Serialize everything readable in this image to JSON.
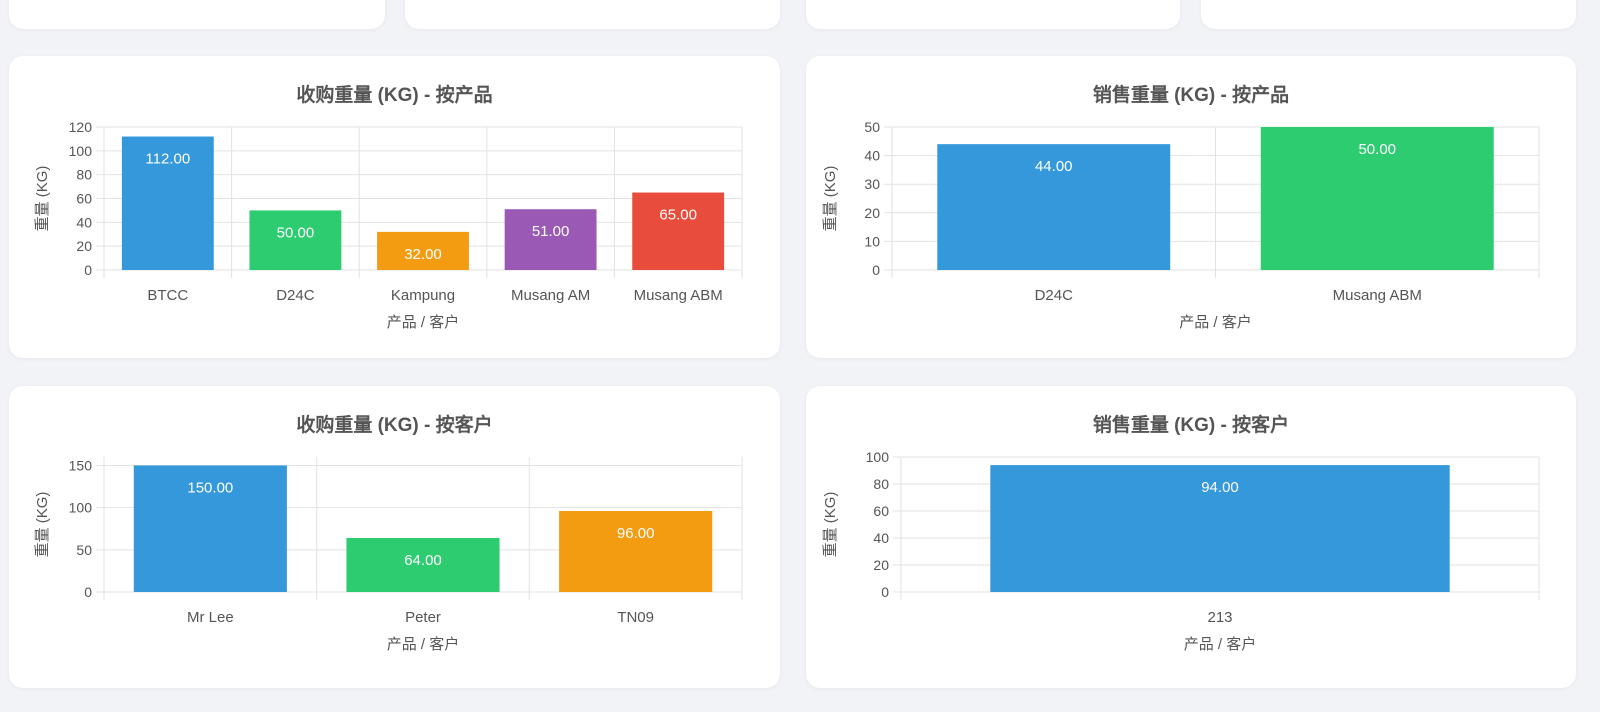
{
  "colors": {
    "blue": "#3498db",
    "green": "#2ecc71",
    "orange": "#f39c12",
    "purple": "#9b59b6",
    "red": "#e74c3c",
    "text": "#555555",
    "grid": "#e2e2e2"
  },
  "charts": {
    "purchase_by_product": {
      "title": "收购重量 (KG) - 按产品",
      "xlabel": "产品 / 客户",
      "ylabel": "重量 (KG)"
    },
    "sales_by_product": {
      "title": "销售重量 (KG) - 按产品",
      "xlabel": "产品 / 客户",
      "ylabel": "重量 (KG)"
    },
    "purchase_by_customer": {
      "title": "收购重量 (KG) - 按客户",
      "xlabel": "产品 / 客户",
      "ylabel": "重量 (KG)"
    },
    "sales_by_customer": {
      "title": "销售重量 (KG) - 按客户",
      "xlabel": "产品 / 客户",
      "ylabel": "重量 (KG)"
    }
  },
  "chart_data": [
    {
      "type": "bar",
      "title": "收购重量 (KG) - 按产品",
      "xlabel": "产品 / 客户",
      "ylabel": "重量 (KG)",
      "categories": [
        "BTCC",
        "D24C",
        "Kampung",
        "Musang AM",
        "Musang ABM"
      ],
      "values": [
        112,
        50,
        32,
        51,
        65
      ],
      "value_labels": [
        "112.00",
        "50.00",
        "32.00",
        "51.00",
        "65.00"
      ],
      "colors": [
        "#3498db",
        "#2ecc71",
        "#f39c12",
        "#9b59b6",
        "#e74c3c"
      ],
      "ylim": [
        0,
        120
      ],
      "yticks": [
        0,
        20,
        40,
        60,
        80,
        100,
        120
      ],
      "grid": true
    },
    {
      "type": "bar",
      "title": "销售重量 (KG) - 按产品",
      "xlabel": "产品 / 客户",
      "ylabel": "重量 (KG)",
      "categories": [
        "D24C",
        "Musang ABM"
      ],
      "values": [
        44,
        50
      ],
      "value_labels": [
        "44.00",
        "50.00"
      ],
      "colors": [
        "#3498db",
        "#2ecc71"
      ],
      "ylim": [
        0,
        50
      ],
      "yticks": [
        0,
        10,
        20,
        30,
        40,
        50
      ],
      "grid": true
    },
    {
      "type": "bar",
      "title": "收购重量 (KG) - 按客户",
      "xlabel": "产品 / 客户",
      "ylabel": "重量 (KG)",
      "categories": [
        "Mr Lee",
        "Peter",
        "TN09"
      ],
      "values": [
        150,
        64,
        96
      ],
      "value_labels": [
        "150.00",
        "64.00",
        "96.00"
      ],
      "colors": [
        "#3498db",
        "#2ecc71",
        "#f39c12"
      ],
      "ylim": [
        0,
        160
      ],
      "yticks": [
        0,
        50,
        100,
        150
      ],
      "grid": true
    },
    {
      "type": "bar",
      "title": "销售重量 (KG) - 按客户",
      "xlabel": "产品 / 客户",
      "ylabel": "重量 (KG)",
      "categories": [
        "213"
      ],
      "values": [
        94
      ],
      "value_labels": [
        "94.00"
      ],
      "colors": [
        "#3498db"
      ],
      "ylim": [
        0,
        100
      ],
      "yticks": [
        0,
        20,
        40,
        60,
        80,
        100
      ],
      "grid": true
    }
  ]
}
